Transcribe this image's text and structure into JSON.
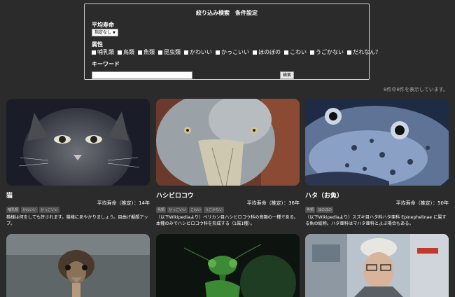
{
  "search": {
    "title": "絞り込み検索　条件設定",
    "lifespan_label": "平均寿命",
    "lifespan_select": "指定なし",
    "attr_label": "属性",
    "attributes": [
      "哺乳類",
      "鳥類",
      "魚類",
      "昆虫類",
      "かわいい",
      "かっこいい",
      "ほのぼの",
      "こわい",
      "うごかない",
      "だれなん？"
    ],
    "keyword_label": "キーワード",
    "keyword_value": "",
    "search_button": "検索"
  },
  "result_count": "8件中8件を表示しています。",
  "cards": [
    {
      "title": "猫",
      "lifespan": "平均寿命（推定）：14年",
      "tags": [
        "哺乳類",
        "かわいい",
        "かっこいい"
      ],
      "desc": "猫様は何をしても許されます。猫様にあやかりましょう。目曲げ擬顔アップ。"
    },
    {
      "title": "ハシビロコウ",
      "lifespan": "平均寿命（推定）：36年",
      "tags": [
        "鳥類",
        "かっこいい",
        "こわい",
        "うごかない"
      ],
      "desc": "（以下Wikipediaより）ペリカン目ハシビロコウ科の鳥類の一種である。本種のみでハシビロコウ科を形成する（1属1種）。"
    },
    {
      "title": "ハタ（お魚）",
      "lifespan": "平均寿命（推定）：50年",
      "tags": [
        "魚類",
        "ほのぼの"
      ],
      "desc": "（以下Wikipediaより）スズキ目ハタ科ハタ亜科 Epinephelinae に属する魚の総称。ハタ亜科はマハタ亜科とよぶ場合もある。"
    }
  ],
  "colors": {
    "background": "#2b2b2b",
    "text": "#ffffff",
    "tag_bg": "#505050"
  }
}
